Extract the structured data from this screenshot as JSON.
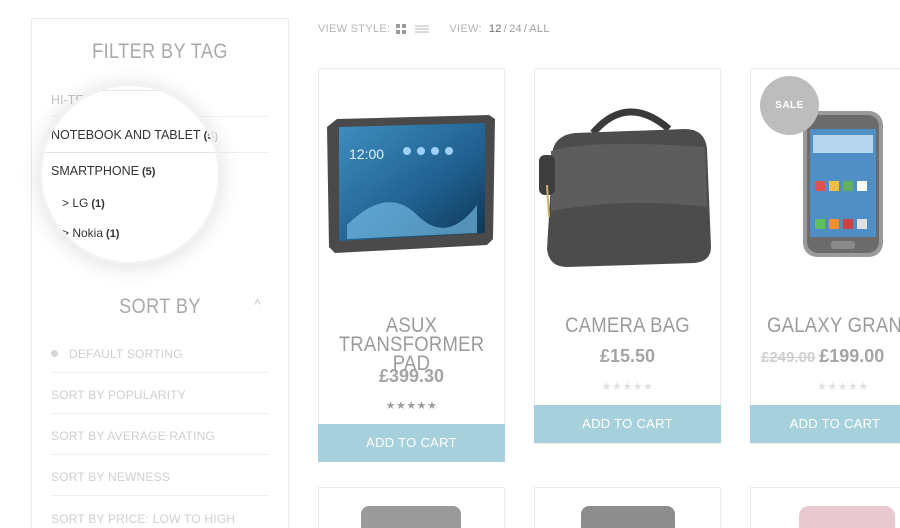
{
  "sidebar": {
    "filter_title": "FILTER BY TAG",
    "tags": {
      "hitech": "HI-TECH",
      "notebook": "NOTEBOOK AND TABLET",
      "notebook_count": "(5)",
      "smartphone": "SMARTPHONE",
      "smartphone_count": "(5)",
      "lg": "> LG",
      "lg_count": "(1)",
      "nokia": "> Nokia",
      "nokia_count": "(1)"
    },
    "sort_title": "SORT BY",
    "sort_options": [
      "DEFAULT SORTING",
      "SORT BY POPULARITY",
      "SORT BY AVERAGE RATING",
      "SORT BY NEWNESS",
      "SORT BY PRICE: LOW TO HIGH"
    ]
  },
  "toolbar": {
    "view_style_label": "VIEW STYLE:",
    "view_label": "VIEW:",
    "view_options": [
      "12",
      "24",
      "ALL"
    ],
    "view_separator": "/"
  },
  "products": [
    {
      "name_line1": "ASUX TRANSFORMER",
      "name_line2": "PAD",
      "price": "£399.30",
      "rating": 5,
      "button": "ADD TO CART"
    },
    {
      "name_line1": "CAMERA BAG",
      "price": "£15.50",
      "rating": 0,
      "button": "ADD TO CART"
    },
    {
      "name_line1": "GALAXY GRAND N",
      "old_price": "£249.00",
      "price": "£199.00",
      "rating": 0,
      "badge": "SALE",
      "button": "ADD TO CART"
    }
  ],
  "stars_glyph": "★★★★★",
  "colors": {
    "cart_button": "#a6d0dc",
    "sale_badge": "#bdbdbd"
  }
}
